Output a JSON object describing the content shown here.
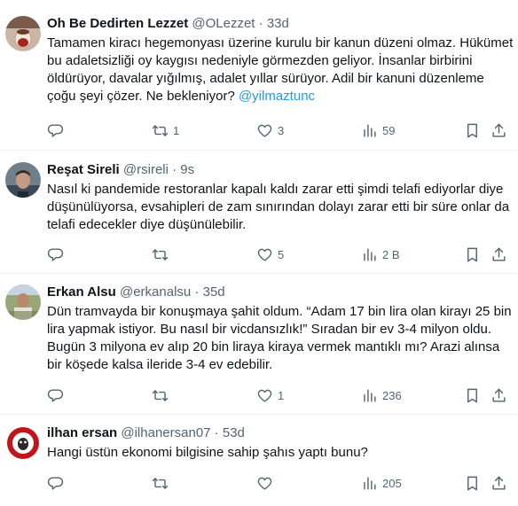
{
  "tweets": [
    {
      "name": "Oh Be Dedirten Lezzet",
      "handle": "@OLezzet",
      "time": "33d",
      "text": "Tamamen kiracı hegemonyası üzerine kurulu bir kanun düzeni olmaz. Hükümet  bu adaletsizliği oy kaygısı nedeniyle görmezden geliyor. İnsanlar birbirini öldürüyor, davalar yığılmış, adalet yıllar sürüyor. Adil bir kanuni düzenleme çoğu şeyi çözer. Ne bekleniyor?",
      "mention": "@yilmaztunc",
      "replies": "",
      "retweets": "1",
      "likes": "3",
      "views": "59"
    },
    {
      "name": "Reşat Sireli",
      "handle": "@rsireli",
      "time": "9s",
      "text": "Nasıl ki pandemide restoranlar kapalı kaldı zarar etti şimdi telafi ediyorlar diye düşünülüyorsa, evsahipleri de zam sınırından dolayı zarar etti bir süre onlar da telafi edecekler diye düşünülebilir.",
      "mention": "",
      "replies": "",
      "retweets": "",
      "likes": "5",
      "views": "2 B"
    },
    {
      "name": "Erkan Alsu",
      "handle": "@erkanalsu",
      "time": "35d",
      "text": "Dün tramvayda bir konuşmaya şahit oldum. “Adam 17 bin lira olan kirayı 25 bin lira yapmak istiyor. Bu nasıl bir vicdansızlık!” Sıradan bir ev 3-4 milyon oldu. Bugün 3 milyona ev alıp 20 bin liraya kiraya vermek mantıklı mı? Arazi alınsa bir köşede kalsa ileride 3-4 ev edebilir.",
      "mention": "",
      "replies": "",
      "retweets": "",
      "likes": "1",
      "views": "236"
    },
    {
      "name": "ilhan ersan",
      "handle": "@ilhanersan07",
      "time": "53d",
      "text": "Hangi üstün ekonomi bilgisine sahip şahıs yaptı bunu?",
      "mention": "",
      "replies": "",
      "retweets": "",
      "likes": "",
      "views": "205"
    }
  ],
  "icons": [
    "reply-icon",
    "retweet-icon",
    "like-icon",
    "views-icon",
    "bookmark-icon",
    "share-icon"
  ],
  "colors": {
    "text": "#0f1419",
    "muted": "#536471",
    "link": "#1d9bf0",
    "divider": "#eff3f4"
  }
}
